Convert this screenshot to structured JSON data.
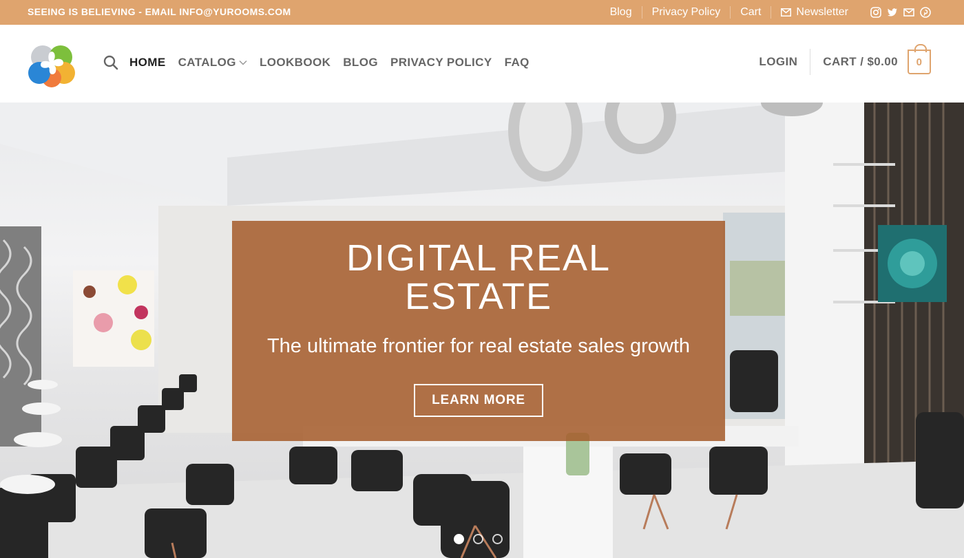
{
  "topbar": {
    "tagline": "SEEING IS BELIEVING - EMAIL INFO@YUROOMS.COM",
    "links": [
      "Blog",
      "Privacy Policy",
      "Cart",
      "Newsletter"
    ],
    "social_icons": [
      "instagram-icon",
      "twitter-icon",
      "email-icon",
      "pinterest-icon"
    ]
  },
  "nav": {
    "items": [
      "HOME",
      "CATALOG",
      "LOOKBOOK",
      "BLOG",
      "PRIVACY POLICY",
      "FAQ"
    ],
    "login": "LOGIN",
    "cart": "CART / $0.00",
    "cart_count": "0"
  },
  "hero": {
    "title_line1": "DIGITAL REAL",
    "title_line2": "ESTATE",
    "subtitle": "The ultimate frontier for real estate sales growth",
    "button": "LEARN MORE",
    "slides": 3,
    "active_slide": 1
  },
  "colors": {
    "accent": "#dfa46e",
    "overlay": "#a55c2b"
  }
}
